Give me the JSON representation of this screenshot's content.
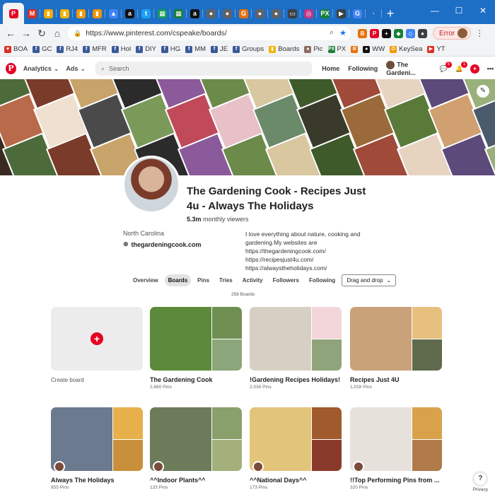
{
  "browser": {
    "url": "https://www.pinterest.com/cspeake/boards/",
    "error_label": "Error",
    "new_tab": "+",
    "window": {
      "minimize": "—",
      "maximize": "☐",
      "close": "✕"
    },
    "tabs": [
      {
        "icon": "P",
        "color": "#e60023",
        "active": true
      },
      {
        "icon": "M",
        "color": "#d93025"
      },
      {
        "icon": "▮",
        "color": "#f9ab00"
      },
      {
        "icon": "▮",
        "color": "#f4b400"
      },
      {
        "icon": "▮",
        "color": "#f29900"
      },
      {
        "icon": "▮",
        "color": "#f09300"
      },
      {
        "icon": "▲",
        "color": "#4285f4"
      },
      {
        "icon": "a",
        "color": "#111111"
      },
      {
        "icon": "t",
        "color": "#1da1f2"
      },
      {
        "icon": "▦",
        "color": "#0f9d58"
      },
      {
        "icon": "▦",
        "color": "#188038"
      },
      {
        "icon": "a",
        "color": "#111111"
      },
      {
        "icon": "●",
        "color": "#5f6368"
      },
      {
        "icon": "●",
        "color": "#5f6368"
      },
      {
        "icon": "G",
        "color": "#e8710a"
      },
      {
        "icon": "●",
        "color": "#5f6368"
      },
      {
        "icon": "●",
        "color": "#5f6368"
      },
      {
        "icon": "▭",
        "color": "#3c4043"
      },
      {
        "icon": "◎",
        "color": "#c13584"
      },
      {
        "icon": "PX",
        "color": "#188038"
      },
      {
        "icon": "▶",
        "color": "#3c4043"
      },
      {
        "icon": "G",
        "color": "#4285f4"
      },
      {
        "icon": "·",
        "color": "#1d6ec5"
      }
    ],
    "extensions": [
      {
        "icon": "B",
        "color": "#e8710a"
      },
      {
        "icon": "P",
        "color": "#e60023"
      },
      {
        "icon": "+",
        "color": "#111111"
      },
      {
        "icon": "◆",
        "color": "#188038"
      },
      {
        "icon": "◇",
        "color": "#4285f4"
      },
      {
        "icon": "●",
        "color": "#3c4043"
      }
    ]
  },
  "bookmarks": [
    {
      "label": "BOA",
      "icon": "♥",
      "color": "#d93025"
    },
    {
      "label": "GC",
      "icon": "f",
      "color": "#3b5998"
    },
    {
      "label": "RJ4",
      "icon": "f",
      "color": "#3b5998"
    },
    {
      "label": "MFR",
      "icon": "f",
      "color": "#3b5998"
    },
    {
      "label": "Hol",
      "icon": "f",
      "color": "#3b5998"
    },
    {
      "label": "DIY",
      "icon": "f",
      "color": "#3b5998"
    },
    {
      "label": "HG",
      "icon": "f",
      "color": "#3b5998"
    },
    {
      "label": "MM",
      "icon": "f",
      "color": "#3b5998"
    },
    {
      "label": "JE",
      "icon": "f",
      "color": "#3b5998"
    },
    {
      "label": "Groups",
      "icon": "f",
      "color": "#3b5998"
    },
    {
      "label": "Boards",
      "icon": "▮",
      "color": "#f4b400"
    },
    {
      "label": "Pic",
      "icon": "●",
      "color": "#8d6e63"
    },
    {
      "label": "PX",
      "icon": "PX",
      "color": "#188038"
    },
    {
      "label": "",
      "icon": "B",
      "color": "#e8710a"
    },
    {
      "label": "WW",
      "icon": "●",
      "color": "#111111"
    },
    {
      "label": "KeySea",
      "icon": "O",
      "color": "#f29900"
    },
    {
      "label": "YT",
      "icon": "▶",
      "color": "#d93025"
    }
  ],
  "pin_header": {
    "analytics": "Analytics",
    "ads": "Ads",
    "search_placeholder": "Search",
    "home": "Home",
    "following": "Following",
    "profile": "The Gardeni...",
    "messages_badge": "5",
    "notifications_badge": "1"
  },
  "profile": {
    "name": "The Gardening Cook - Recipes Just 4u - Always The Holidays",
    "monthly_value": "5.3m",
    "monthly_label": "monthly viewers",
    "location": "North Carolina",
    "website": "thegardeningcook.com",
    "bio_lines": [
      "I love everything about nature, cooking and",
      "gardening.My websites are",
      "https://thegardeningcook.com/",
      "https://recipesjust4u.com/",
      "https://alwaystheholidays.com/"
    ]
  },
  "tabs": {
    "items": [
      "Overview",
      "Boards",
      "Pins",
      "Tries",
      "Activity",
      "Followers",
      "Following"
    ],
    "active": 1,
    "sort_label": "Drag and drop",
    "board_count": "258 Boards"
  },
  "create_board": {
    "label": "Create board"
  },
  "boards": [
    {
      "title": "The Gardening Cook",
      "pins": "2,680 Pins",
      "colors": [
        "#5c8a3a",
        "#6f8f52",
        "#8aa67a"
      ]
    },
    {
      "title": "!Gardening Recipes Holidays!",
      "pins": "2,036 Pins",
      "colors": [
        "#d8cfc4",
        "#f3d6da",
        "#8fa47a"
      ]
    },
    {
      "title": "Recipes Just 4U",
      "pins": "1,018 Pins",
      "colors": [
        "#c9a27a",
        "#e7c07f",
        "#5f6b4c"
      ]
    },
    {
      "title": "Always The Holidays",
      "pins": "855 Pins",
      "colors": [
        "#6b7a8f",
        "#e8b04a",
        "#c98f3a"
      ]
    },
    {
      "title": "^^Indoor Plants^^",
      "pins": "133 Pins",
      "colors": [
        "#6c7c5a",
        "#8aa06a",
        "#a3b07c"
      ]
    },
    {
      "title": "^^National Days^^",
      "pins": "173 Pins",
      "colors": [
        "#e2c47a",
        "#a05a2c",
        "#8a3a2a"
      ]
    },
    {
      "title": "!!Top Performing Pins from ...",
      "pins": "320 Pins",
      "colors": [
        "#e7e1dc",
        "#d9a24a",
        "#b07a4a"
      ]
    }
  ],
  "footer": {
    "help": "?",
    "privacy": "Privacy"
  }
}
